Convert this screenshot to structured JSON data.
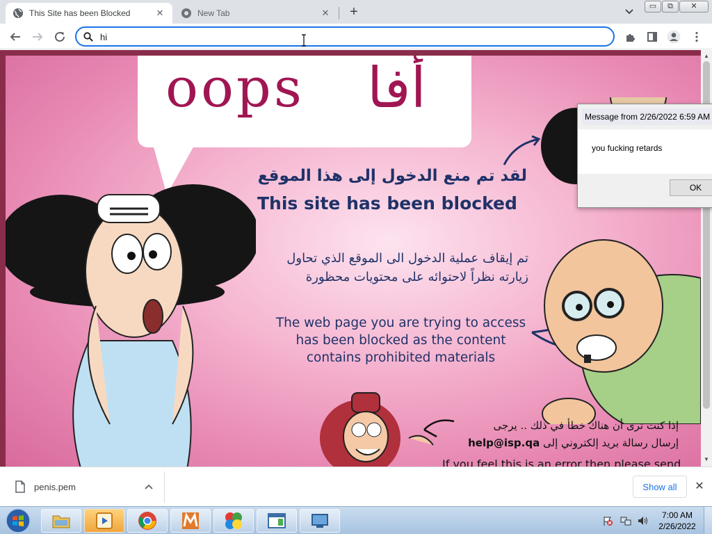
{
  "browser": {
    "tabs": [
      {
        "title": "This Site has been Blocked",
        "active": true
      },
      {
        "title": "New Tab",
        "active": false
      }
    ],
    "new_tab_symbol": "+",
    "close_symbol": "✕",
    "address_value": "hi",
    "icons": [
      "back-arrow-icon",
      "forward-arrow-icon",
      "reload-icon",
      "search-icon",
      "extensions-puzzle-icon",
      "side-panel-icon",
      "profile-icon",
      "kebab-menu-icon",
      "tab-search-chevron-icon"
    ],
    "window_controls": {
      "minimize": "▭",
      "maximize": "⧉",
      "close": "✕"
    }
  },
  "page": {
    "oops_en": "oops",
    "oops_ar": "أفا",
    "heading_ar": "لقد تم منع الدخول إلى هذا الموقع",
    "heading_en": "This site has been blocked",
    "message_ar": "تم إيقاف عملية الدخول الى الموقع الذي تحاول زيارته نظراً لاحتوائه على محتويات محظورة",
    "message_en": "The web page you are trying to access has been blocked as the content contains prohibited materials",
    "contact_ar_line1": "إذا كنت ترى أن هناك خطأ في ذلك .. يرجى",
    "contact_ar_line2_text": "إرسال رسالة بريد إلكتروني إلى",
    "contact_email": "help@isp.qa",
    "contact_en": "If you feel this is an error then please send",
    "colors": {
      "frame": "#8a2d4a",
      "heading": "#1f3268",
      "oops": "#a01652"
    }
  },
  "dialog": {
    "title": "Message from  2/26/2022 6:59 AM",
    "body": "you fucking retards",
    "ok_label": "OK"
  },
  "downloads": {
    "file_name": "penis.pem",
    "show_all_label": "Show all",
    "close_symbol": "✕"
  },
  "taskbar": {
    "apps": [
      "windows-explorer",
      "media-center",
      "chrome",
      "m-app",
      "puzzle-app",
      "window-app",
      "remote-desktop"
    ],
    "clock_time": "7:00 AM",
    "clock_date": "2/26/2022"
  }
}
